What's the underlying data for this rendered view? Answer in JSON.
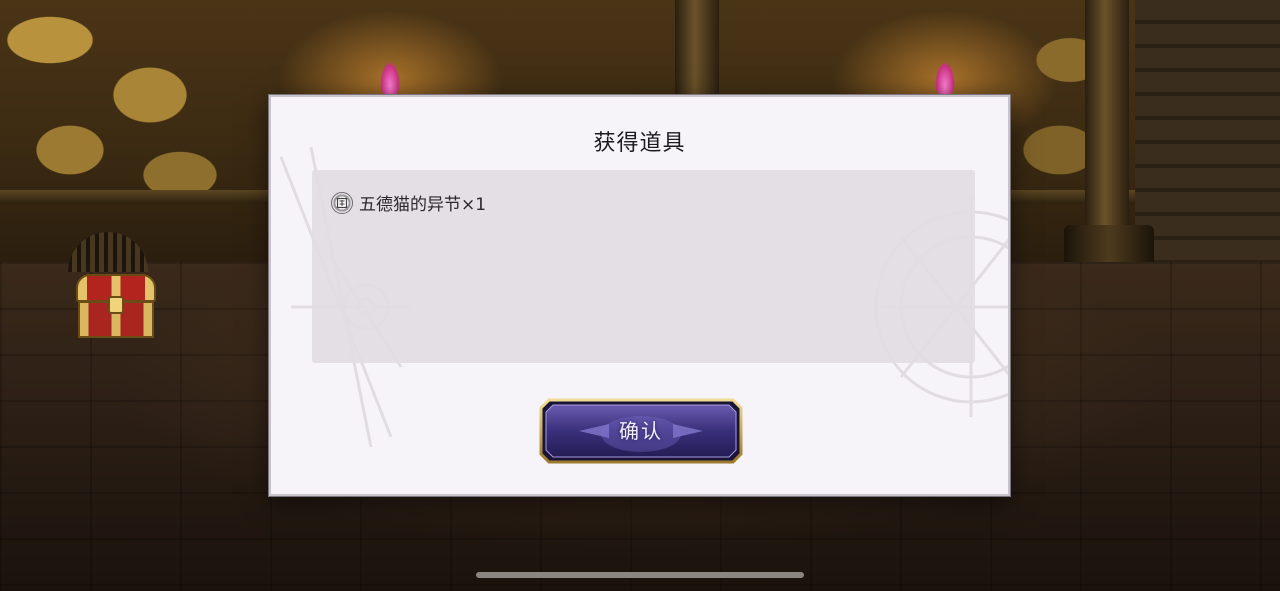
{
  "dialog": {
    "title": "获得道具",
    "items": [
      {
        "name": "五德猫的异节×1",
        "icon": "scroll-badge-icon"
      }
    ],
    "confirm_label": "确认"
  },
  "colors": {
    "dialog_bg": "#f6f4f8",
    "panel_bg": "#e1dce2",
    "button_purple": "#3a2f7a",
    "button_gold": "#c9a94e"
  }
}
